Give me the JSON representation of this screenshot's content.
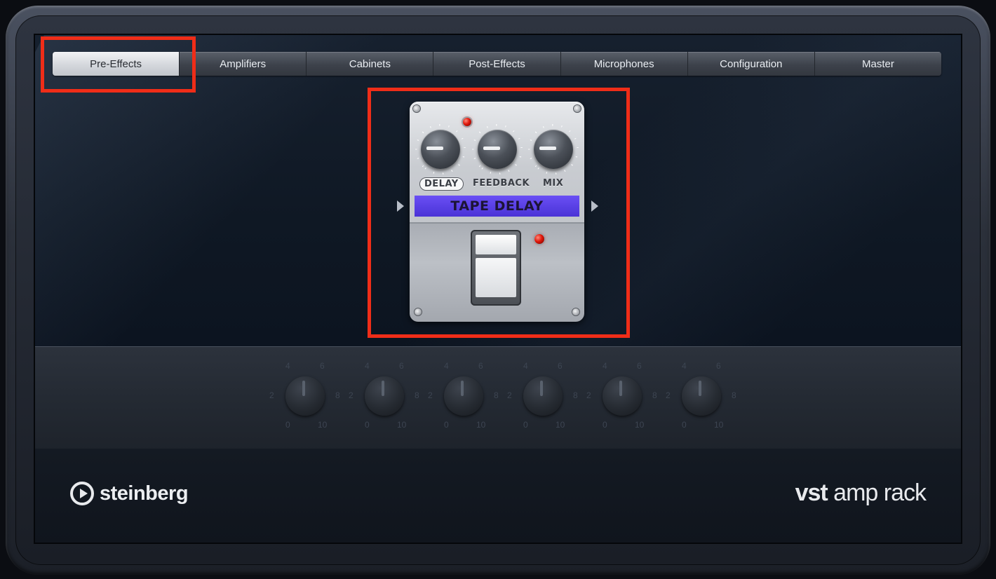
{
  "tabs": [
    {
      "label": "Pre-Effects",
      "active": true
    },
    {
      "label": "Amplifiers",
      "active": false
    },
    {
      "label": "Cabinets",
      "active": false
    },
    {
      "label": "Post-Effects",
      "active": false
    },
    {
      "label": "Microphones",
      "active": false
    },
    {
      "label": "Configuration",
      "active": false
    },
    {
      "label": "Master",
      "active": false
    }
  ],
  "pedal": {
    "knobs": [
      "DELAY",
      "FEEDBACK",
      "MIX"
    ],
    "name": "TAPE DELAY",
    "name_color": "#5a40ea"
  },
  "amp_knob_scale": {
    "top_left": "4",
    "top_right": "6",
    "left": "2",
    "right": "8",
    "bottom_left": "0",
    "bottom_right": "10"
  },
  "footer": {
    "logo_text": "steinberg",
    "product_bold": "vst",
    "product_light": " amp rack"
  },
  "colors": {
    "highlight": "#f02d18",
    "background": "#0c1420"
  }
}
